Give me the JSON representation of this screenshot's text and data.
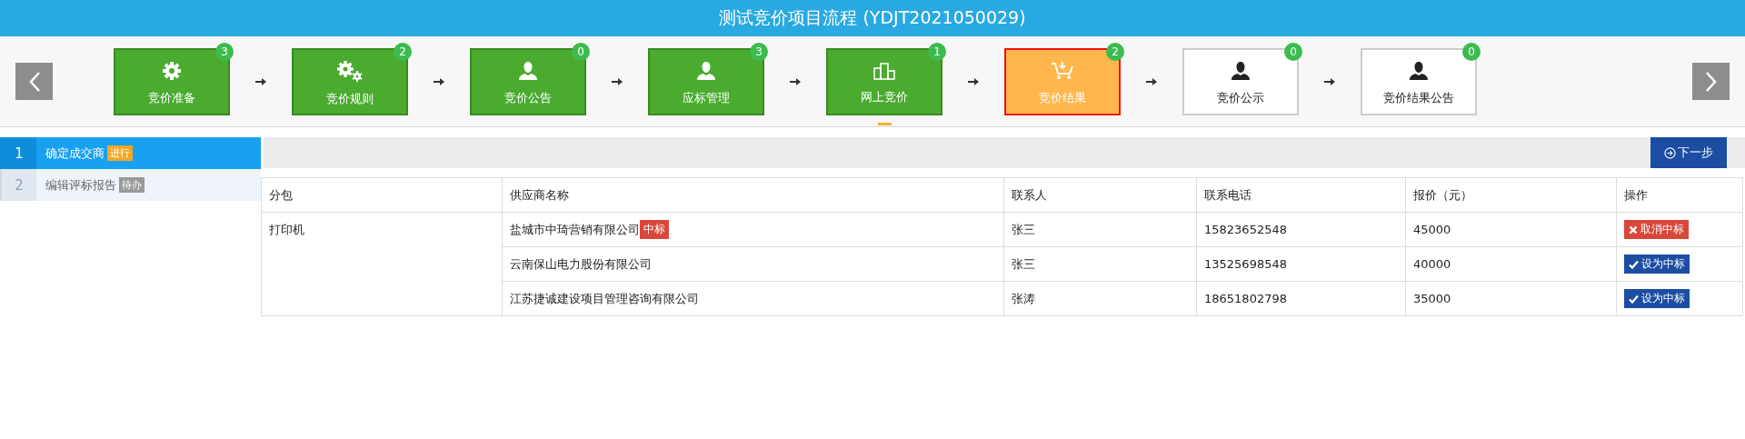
{
  "header": {
    "title": "测试竞价项目流程 (YDJT2021050029)"
  },
  "steps": [
    {
      "label": "竞价准备",
      "count": "3",
      "kind": "done",
      "underlined": false
    },
    {
      "label": "竞价规则",
      "count": "2",
      "kind": "done",
      "underlined": false
    },
    {
      "label": "竞价公告",
      "count": "0",
      "kind": "done",
      "underlined": false
    },
    {
      "label": "应标管理",
      "count": "3",
      "kind": "done",
      "underlined": false
    },
    {
      "label": "网上竞价",
      "count": "1",
      "kind": "done",
      "underlined": true
    },
    {
      "label": "竞价结果",
      "count": "2",
      "kind": "current",
      "underlined": false
    },
    {
      "label": "竞价公示",
      "count": "0",
      "kind": "pending",
      "underlined": false
    },
    {
      "label": "竞价结果公告",
      "count": "0",
      "kind": "pending",
      "underlined": false
    }
  ],
  "sidebar": {
    "items": [
      {
        "number": "1",
        "label": "确定成交商",
        "badge": "进行",
        "selected": true
      },
      {
        "number": "2",
        "label": "编辑评标报告",
        "badge": "待办",
        "selected": false
      }
    ]
  },
  "toolbar": {
    "next_button": "下一步"
  },
  "table": {
    "columns": [
      "分包",
      "供应商名称",
      "联系人",
      "联系电话",
      "报价（元）",
      "操作"
    ],
    "package": "打印机",
    "rows": [
      {
        "supplier": "盐城市中琦营销有限公司",
        "tag": "中标",
        "contact": "张三",
        "phone": "15823652548",
        "price": "45000",
        "won": true,
        "action": "取消中标"
      },
      {
        "supplier": "云南保山电力股份有限公司",
        "contact": "张三",
        "phone": "13525698548",
        "price": "40000",
        "won": false,
        "action": "设为中标"
      },
      {
        "supplier": "江苏捷诚建设项目管理咨询有限公司",
        "contact": "张涛",
        "phone": "18651802798",
        "price": "35000",
        "won": false,
        "action": "设为中标"
      }
    ]
  }
}
